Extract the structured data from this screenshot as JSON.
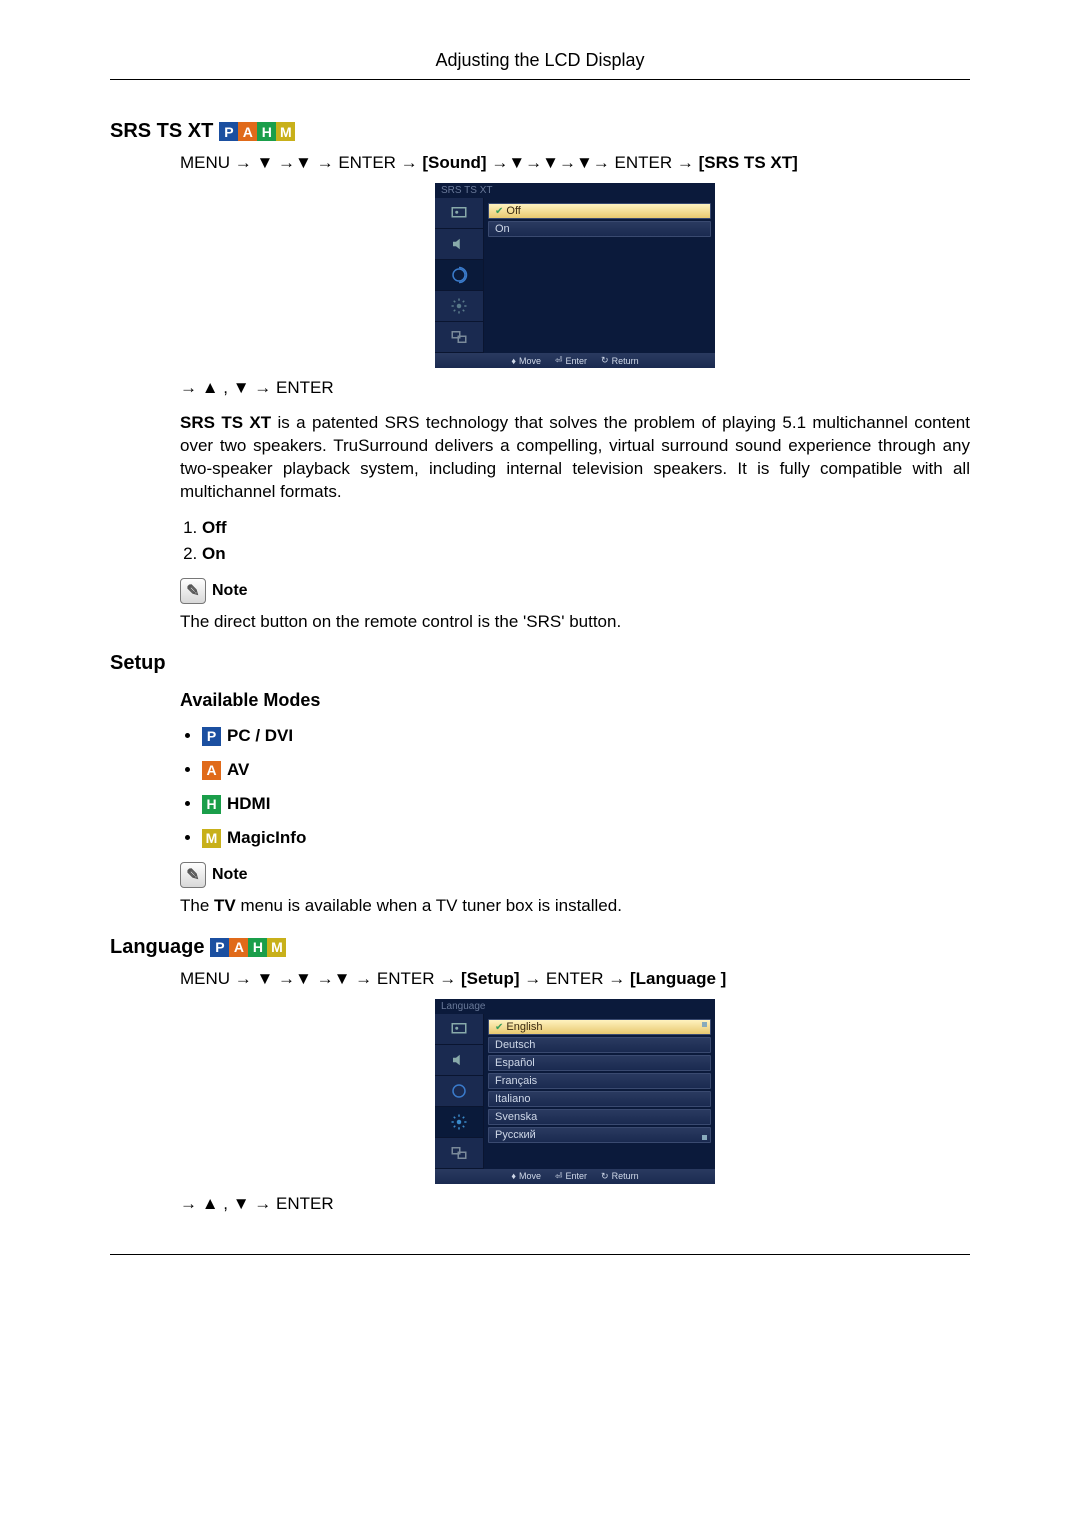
{
  "header": "Adjusting the LCD Display",
  "section1": {
    "title": "SRS TS XT",
    "badges": [
      "P",
      "A",
      "H",
      "M"
    ],
    "nav1_a": "MENU → ▼ →▼ → ENTER → ",
    "nav1_b": "[Sound]",
    "nav1_c": " →▼→▼→▼→ ENTER → ",
    "nav1_d": "[SRS TS XT]",
    "osd": {
      "title": "SRS TS XT",
      "items": [
        "Off",
        "On"
      ],
      "footer": {
        "move": "Move",
        "enter": "Enter",
        "return": "Return"
      }
    },
    "nav2": "→ ▲ , ▼ → ENTER",
    "desc_b": "SRS TS XT",
    "desc": " is a patented SRS technology that solves the problem of playing 5.1 multichannel content over two speakers. TruSurround delivers a compelling, virtual surround sound experience through any two-speaker playback system, including internal television speakers. It is fully compatible with all multichannel formats.",
    "opt1": "Off",
    "opt2": "On",
    "note_label": "Note",
    "note_text": "The direct button on the remote control is the 'SRS' button."
  },
  "section2": {
    "title": "Setup",
    "sub": "Available Modes",
    "modes": [
      {
        "badge": "P",
        "label": "PC / DVI"
      },
      {
        "badge": "A",
        "label": "AV"
      },
      {
        "badge": "H",
        "label": "HDMI"
      },
      {
        "badge": "M",
        "label": "MagicInfo"
      }
    ],
    "note_label": "Note",
    "note_text_a": "The ",
    "note_text_b": "TV",
    "note_text_c": " menu is available when a TV tuner box is installed."
  },
  "section3": {
    "title": "Language",
    "badges": [
      "P",
      "A",
      "H",
      "M"
    ],
    "nav1_a": "MENU → ▼ →▼ →▼ → ENTER → ",
    "nav1_b": "[Setup]",
    "nav1_c": " → ENTER → ",
    "nav1_d": "[Language ]",
    "osd": {
      "title": "Language",
      "items": [
        "English",
        "Deutsch",
        "Español",
        "Français",
        "Italiano",
        "Svenska",
        "Русский"
      ],
      "footer": {
        "move": "Move",
        "enter": "Enter",
        "return": "Return"
      }
    },
    "nav2": "→ ▲ , ▼ → ENTER"
  }
}
